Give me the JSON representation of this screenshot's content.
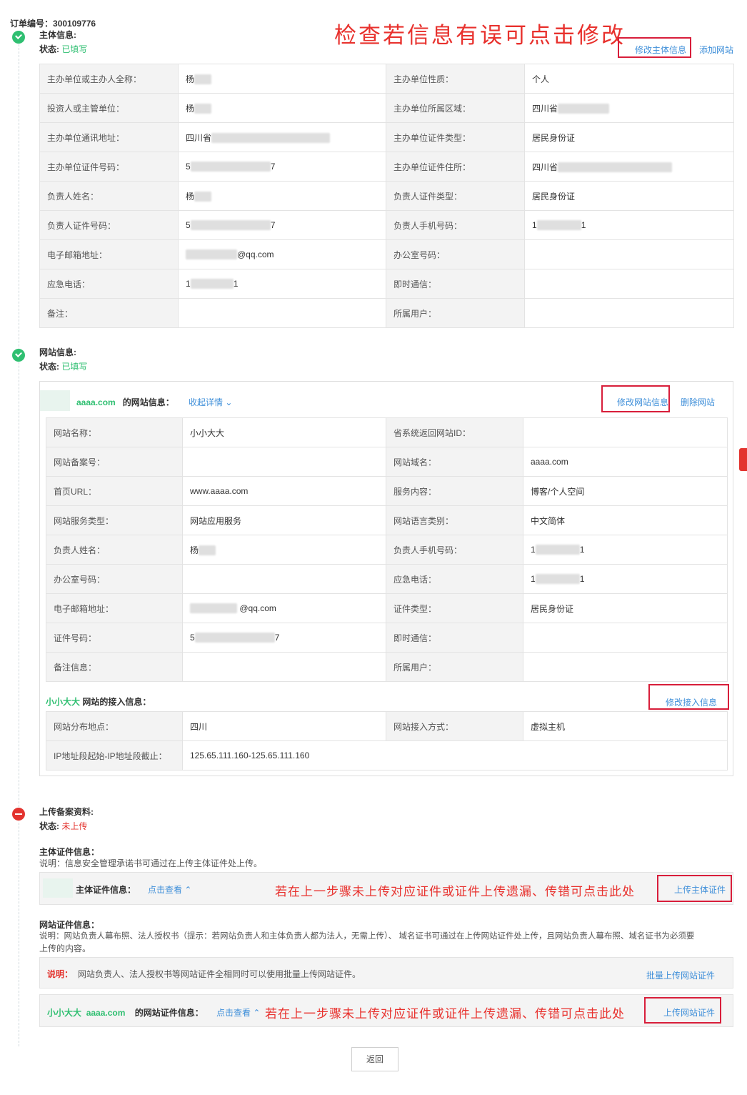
{
  "order": {
    "label": "订单编号：",
    "number": "300109776"
  },
  "annotations": {
    "top": "检查若信息有误可点击修改",
    "upload_main": "若在上一步骤未上传对应证件或证件上传遗漏、传错可点击此处",
    "upload_site": "若在上一步骤未上传对应证件或证件上传遗漏、传错可点击此处"
  },
  "subject": {
    "title": "主体信息:",
    "status_label": "状态:",
    "status_value": "已填写",
    "edit_link": "修改主体信息",
    "add_site_link": "添加网站",
    "rows": [
      {
        "k1": "主办单位或主办人全称：",
        "v1": "杨",
        "k2": "主办单位性质：",
        "v2": "个人"
      },
      {
        "k1": "投资人或主管单位：",
        "v1": "杨",
        "k2": "主办单位所属区域：",
        "v2": "四川省"
      },
      {
        "k1": "主办单位通讯地址：",
        "v1": "四川省",
        "k2": "主办单位证件类型：",
        "v2": "居民身份证"
      },
      {
        "k1": "主办单位证件号码：",
        "v1": "5",
        "v1b": "7",
        "k2": "主办单位证件住所：",
        "v2": "四川省"
      },
      {
        "k1": "负责人姓名：",
        "v1": "杨",
        "k2": "负责人证件类型：",
        "v2": "居民身份证"
      },
      {
        "k1": "负责人证件号码：",
        "v1": "5",
        "v1b": "7",
        "k2": "负责人手机号码：",
        "v2": "1",
        "v2b": "1"
      },
      {
        "k1": "电子邮箱地址：",
        "v1": "",
        "v1b": "@qq.com",
        "k2": "办公室号码：",
        "v2": ""
      },
      {
        "k1": "应急电话：",
        "v1": "1",
        "v1b": "1",
        "k2": "即时通信：",
        "v2": ""
      },
      {
        "k1": "备注：",
        "v1": "",
        "k2": "所属用户：",
        "v2": ""
      }
    ]
  },
  "website": {
    "title": "网站信息:",
    "status_label": "状态:",
    "status_value": "已填写",
    "domain": "aaaa.com",
    "info_suffix": "的网站信息：",
    "collapse_link": "收起详情",
    "edit_link": "修改网站信息",
    "delete_link": "删除网站",
    "rows": [
      {
        "k1": "网站名称：",
        "v1": "小小大大",
        "k2": "省系统返回网站ID：",
        "v2": ""
      },
      {
        "k1": "网站备案号：",
        "v1": "",
        "k2": "网站域名：",
        "v2": "aaaa.com"
      },
      {
        "k1": "首页URL：",
        "v1": "www.aaaa.com",
        "k2": "服务内容：",
        "v2": "博客/个人空间"
      },
      {
        "k1": "网站服务类型：",
        "v1": "网站应用服务",
        "k2": "网站语言类别：",
        "v2": "中文简体"
      },
      {
        "k1": "负责人姓名：",
        "v1": "杨",
        "k2": "负责人手机号码：",
        "v2": "1",
        "v2b": "1"
      },
      {
        "k1": "办公室号码：",
        "v1": "",
        "k2": "应急电话：",
        "v2": "1",
        "v2b": "1"
      },
      {
        "k1": "电子邮箱地址：",
        "v1": "",
        "v1b": "@qq.com",
        "k2": "证件类型：",
        "v2": "居民身份证"
      },
      {
        "k1": "证件号码：",
        "v1": "5",
        "v1b": "7",
        "k2": "即时通信：",
        "v2": ""
      },
      {
        "k1": "备注信息：",
        "v1": "",
        "k2": "所属用户：",
        "v2": ""
      }
    ],
    "access": {
      "site_name": "小小大大",
      "title_suffix": "网站的接入信息：",
      "edit_link": "修改接入信息",
      "row1": {
        "k1": "网站分布地点：",
        "v1": "四川",
        "k2": "网站接入方式：",
        "v2": "虚拟主机"
      },
      "row2": {
        "k1": "IP地址段起始-IP地址段截止：",
        "v1": "125.65.111.160-125.65.111.160"
      }
    }
  },
  "upload": {
    "title": "上传备案资料:",
    "status_label": "状态:",
    "status_value": "未上传",
    "main_cert_title": "主体证件信息：",
    "main_cert_desc": "说明：信息安全管理承诺书可通过在上传主体证件处上传。",
    "main_cert_row_label": "主体证件信息：",
    "view_link": "点击查看",
    "upload_main_link": "上传主体证件",
    "site_cert_title": "网站证件信息：",
    "site_cert_desc1": "说明：网站负责人幕布照、法人授权书（提示：若网站负责人和主体负责人都为法人，无需上传）、 域名证书可通过在上传网站证件处上传，且网站负责人幕布照、域名证书为必须要",
    "site_cert_desc2": "上传的内容。",
    "note_label": "说明：",
    "note_text": "网站负责人、法人授权书等网站证件全相同时可以使用批量上传网站证件。",
    "batch_link": "批量上传网站证件",
    "site_name": "小小大大",
    "domain": "aaaa.com",
    "site_cert_row_label": "的网站证件信息：",
    "view_link2": "点击查看",
    "upload_site_link": "上传网站证件"
  },
  "back_button": "返回"
}
